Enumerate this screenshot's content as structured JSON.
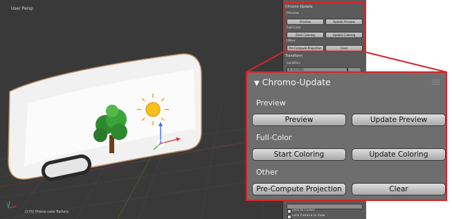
{
  "viewport": {
    "label": "User Persp",
    "footer": "(170) Phone case flattery"
  },
  "side_panel": {
    "panel_title": "Chromo-Update",
    "preview_label": "Preview",
    "preview_button": "Preview",
    "update_preview_button": "Update Preview",
    "fullcolor_label": "Full-Color",
    "start_coloring_button": "Start Coloring",
    "update_coloring_button": "Update Coloring",
    "other_label": "Other",
    "precompute_button": "Pre-Compute Projection",
    "clear_button": "Clear",
    "transform_title": "Transform",
    "location_label": "Location:",
    "location_x_axis": "X:",
    "location_x_value": "0.17451",
    "lock_label": "Lock to Cursor",
    "lock_label_2": "Lock Camera to View"
  },
  "zoom": {
    "panel_title": "Chromo-Update",
    "preview_section": "Preview",
    "preview_button": "Preview",
    "update_preview_button": "Update Preview",
    "fullcolor_section": "Full-Color",
    "start_coloring_button": "Start Coloring",
    "update_coloring_button": "Update Coloring",
    "other_section": "Other",
    "precompute_button": "Pre-Compute Projection",
    "clear_button": "Clear"
  },
  "colors": {
    "highlight": "#d8232a",
    "panel_bg": "#6e6e6e",
    "viewport_bg": "#393939"
  }
}
